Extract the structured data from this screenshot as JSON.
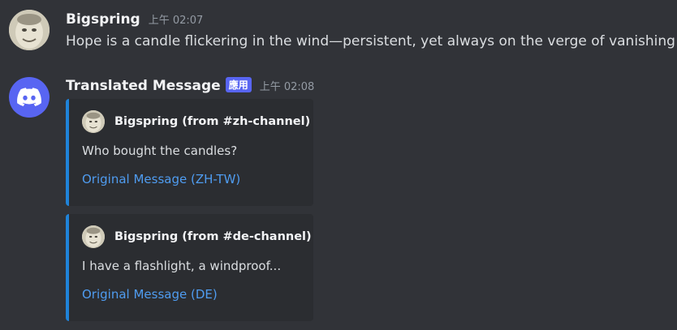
{
  "messages": [
    {
      "author": "Bigspring",
      "time": "上午 02:07",
      "text": "Hope is a candle flickering in the wind—persistent, yet always on the verge of vanishing",
      "avatar_icon": "face-avatar"
    },
    {
      "author": "Translated Message",
      "app_tag": "應用",
      "time": "上午 02:08",
      "avatar_icon": "discord-logo-icon",
      "embeds": [
        {
          "author": "Bigspring (from #zh-channel)",
          "description": "Who bought the candles?",
          "link": "Original Message (ZH-TW)"
        },
        {
          "author": "Bigspring (from #de-channel)",
          "description": "I have a flashlight, a windproof...",
          "link": "Original Message (DE)"
        }
      ]
    }
  ],
  "colors": {
    "background": "#313338",
    "embed_background": "#2b2d31",
    "embed_border": "#1f83d9",
    "link": "#4f9cf0",
    "app_tag": "#5865f2",
    "discord_blurple": "#5865f2"
  }
}
